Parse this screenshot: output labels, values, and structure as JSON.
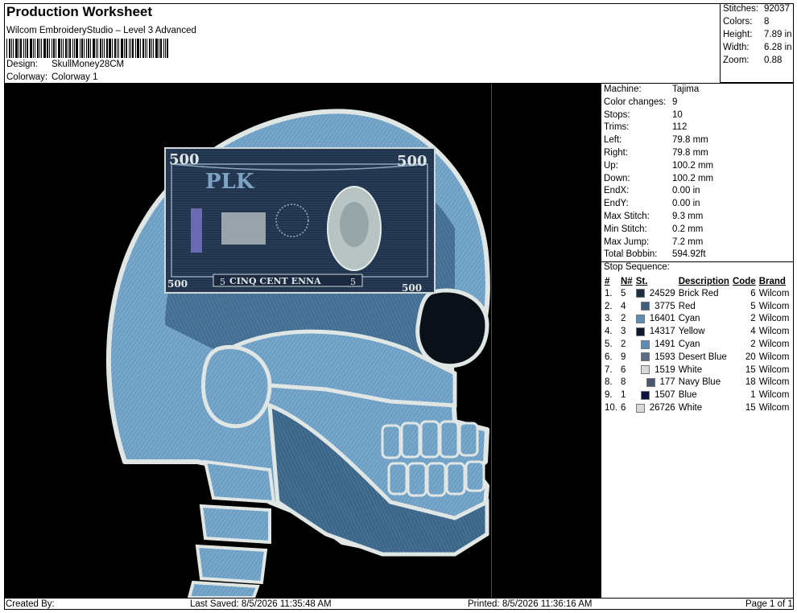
{
  "header": {
    "title": "Production Worksheet",
    "subtitle": "Wilcom EmbroideryStudio – Level 3 Advanced",
    "design_label": "Design:",
    "design_value": "SkullMoney28CM",
    "colorway_label": "Colorway:",
    "colorway_value": "Colorway 1"
  },
  "stats": {
    "stitches_label": "Stitches:",
    "stitches": "92037",
    "colors_label": "Colors:",
    "colors": "8",
    "height_label": "Height:",
    "height": "7.89 in",
    "width_label": "Width:",
    "width": "6.28 in",
    "zoom_label": "Zoom:",
    "zoom": "0.88"
  },
  "machine": [
    {
      "label": "Machine:",
      "value": "Tajima"
    },
    {
      "label": "Color changes:",
      "value": "9"
    },
    {
      "label": "Stops:",
      "value": "10"
    },
    {
      "label": "Trims:",
      "value": "112"
    },
    {
      "label": "Left:",
      "value": "79.8 mm"
    },
    {
      "label": "Right:",
      "value": "79.8 mm"
    },
    {
      "label": "Up:",
      "value": "100.2 mm"
    },
    {
      "label": "Down:",
      "value": "100.2 mm"
    },
    {
      "label": "EndX:",
      "value": "0.00 in"
    },
    {
      "label": "EndY:",
      "value": "0.00 in"
    },
    {
      "label": "Max Stitch:",
      "value": "9.3 mm"
    },
    {
      "label": "Min Stitch:",
      "value": "0.2 mm"
    },
    {
      "label": "Max Jump:",
      "value": "7.2 mm"
    },
    {
      "label": "Total Bobbin:",
      "value": "594.92ft"
    }
  ],
  "stop_sequence": {
    "title": "Stop Sequence:",
    "columns": [
      "#",
      "N#",
      "St.",
      "Description",
      "Code",
      "Brand"
    ],
    "rows": [
      {
        "num": "1.",
        "n": "5",
        "color": "#1e2d3f",
        "st": "24529",
        "desc": "Brick Red",
        "code": "6",
        "brand": "Wilcom"
      },
      {
        "num": "2.",
        "n": "4",
        "color": "#3f5f7e",
        "st": "3775",
        "desc": "Red",
        "code": "5",
        "brand": "Wilcom"
      },
      {
        "num": "3.",
        "n": "2",
        "color": "#5d8db5",
        "st": "16401",
        "desc": "Cyan",
        "code": "2",
        "brand": "Wilcom"
      },
      {
        "num": "4.",
        "n": "3",
        "color": "#0f1a2e",
        "st": "14317",
        "desc": "Yellow",
        "code": "4",
        "brand": "Wilcom"
      },
      {
        "num": "5.",
        "n": "2",
        "color": "#5d8db5",
        "st": "1491",
        "desc": "Cyan",
        "code": "2",
        "brand": "Wilcom"
      },
      {
        "num": "6.",
        "n": "9",
        "color": "#5b6a86",
        "st": "1593",
        "desc": "Desert Blue",
        "code": "20",
        "brand": "Wilcom"
      },
      {
        "num": "7.",
        "n": "6",
        "color": "#d7d9d6",
        "st": "1519",
        "desc": "White",
        "code": "15",
        "brand": "Wilcom"
      },
      {
        "num": "8.",
        "n": "8",
        "color": "#4b5675",
        "st": "177",
        "desc": "Navy Blue",
        "code": "18",
        "brand": "Wilcom"
      },
      {
        "num": "9.",
        "n": "1",
        "color": "#101040",
        "st": "1507",
        "desc": "Blue",
        "code": "1",
        "brand": "Wilcom"
      },
      {
        "num": "10.",
        "n": "6",
        "color": "#d7d9d6",
        "st": "26726",
        "desc": "White",
        "code": "15",
        "brand": "Wilcom"
      }
    ]
  },
  "artwork": {
    "banknote_top_left": "500",
    "banknote_top_right": "500",
    "banknote_code": "PLK",
    "banknote_caption": "CINQ CENT ENNA",
    "banknote_bottom_left": "500",
    "banknote_bottom_right": "500",
    "banknote_small_left": "5",
    "banknote_small_right": "5"
  },
  "footer": {
    "created_by": "Created By:",
    "last_saved": "Last Saved: 8/5/2026 11:35:48 AM",
    "printed": "Printed: 8/5/2026 11:36:16 AM",
    "page": "Page 1 of 1"
  }
}
